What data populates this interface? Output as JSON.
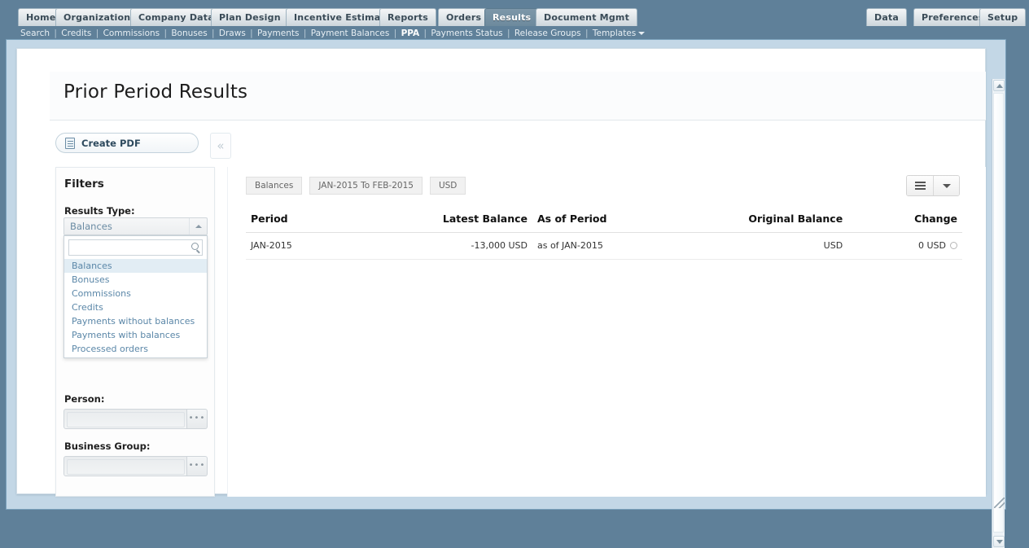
{
  "app": {
    "main_tabs": [
      {
        "label": "Home",
        "active": false
      },
      {
        "label": "Organization",
        "active": false
      },
      {
        "label": "Company Data",
        "active": false
      },
      {
        "label": "Plan Design",
        "active": false
      },
      {
        "label": "Incentive Estimator",
        "active": false
      },
      {
        "label": "Reports",
        "active": false
      },
      {
        "label": "Orders",
        "active": false
      },
      {
        "label": "Results",
        "active": true
      },
      {
        "label": "Document Mgmt",
        "active": false
      }
    ],
    "right_tabs": [
      {
        "label": "Data"
      },
      {
        "label": "Preferences"
      },
      {
        "label": "Setup"
      }
    ],
    "subnav": [
      {
        "label": "Search",
        "current": false
      },
      {
        "label": "Credits",
        "current": false
      },
      {
        "label": "Commissions",
        "current": false
      },
      {
        "label": "Bonuses",
        "current": false
      },
      {
        "label": "Draws",
        "current": false
      },
      {
        "label": "Payments",
        "current": false
      },
      {
        "label": "Payment Balances",
        "current": false
      },
      {
        "label": "PPA",
        "current": true
      },
      {
        "label": "Payments Status",
        "current": false
      },
      {
        "label": "Release Groups",
        "current": false
      },
      {
        "label": "Templates",
        "current": false,
        "has_caret": true
      }
    ]
  },
  "page": {
    "title": "Prior Period Results"
  },
  "toolbar": {
    "create_pdf_label": "Create PDF",
    "collapse_glyph": "«"
  },
  "filters": {
    "title": "Filters",
    "results_type": {
      "label": "Results Type:",
      "value": "Balances",
      "expanded": true,
      "search_value": "",
      "search_placeholder": "",
      "options": [
        {
          "label": "Balances",
          "selected": true
        },
        {
          "label": "Bonuses",
          "selected": false
        },
        {
          "label": "Commissions",
          "selected": false
        },
        {
          "label": "Credits",
          "selected": false
        },
        {
          "label": "Payments without balances",
          "selected": false
        },
        {
          "label": "Payments with balances",
          "selected": false
        },
        {
          "label": "Processed orders",
          "selected": false
        }
      ]
    },
    "person": {
      "label": "Person:",
      "value": "",
      "button_label": "•••"
    },
    "business_group": {
      "label": "Business Group:",
      "value": "",
      "button_label": "•••"
    }
  },
  "main": {
    "chips": [
      {
        "label": "Balances"
      },
      {
        "label": "JAN-2015 To FEB-2015"
      },
      {
        "label": "USD"
      }
    ],
    "view_buttons": [
      {
        "name": "list-view",
        "icon": "list-icon"
      },
      {
        "name": "view-options",
        "icon": "caret-down-icon"
      }
    ],
    "table": {
      "columns": [
        {
          "label": "Period",
          "align": "left"
        },
        {
          "label": "Latest Balance",
          "align": "right"
        },
        {
          "label": "As of Period",
          "align": "left"
        },
        {
          "label": "Original Balance",
          "align": "right"
        },
        {
          "label": "Change",
          "align": "right"
        }
      ],
      "rows": [
        {
          "period": "JAN-2015",
          "latest_balance": "-13,000 USD",
          "as_of_period": "as of JAN-2015",
          "original_balance": "USD",
          "change": "0  USD"
        }
      ]
    }
  },
  "colors": {
    "chrome": "#5f8099",
    "workspace": "#c3d7e6",
    "active_tab": "#6d8a9d",
    "link": "#5b87a8",
    "selected_option_bg": "#e2edf4"
  }
}
